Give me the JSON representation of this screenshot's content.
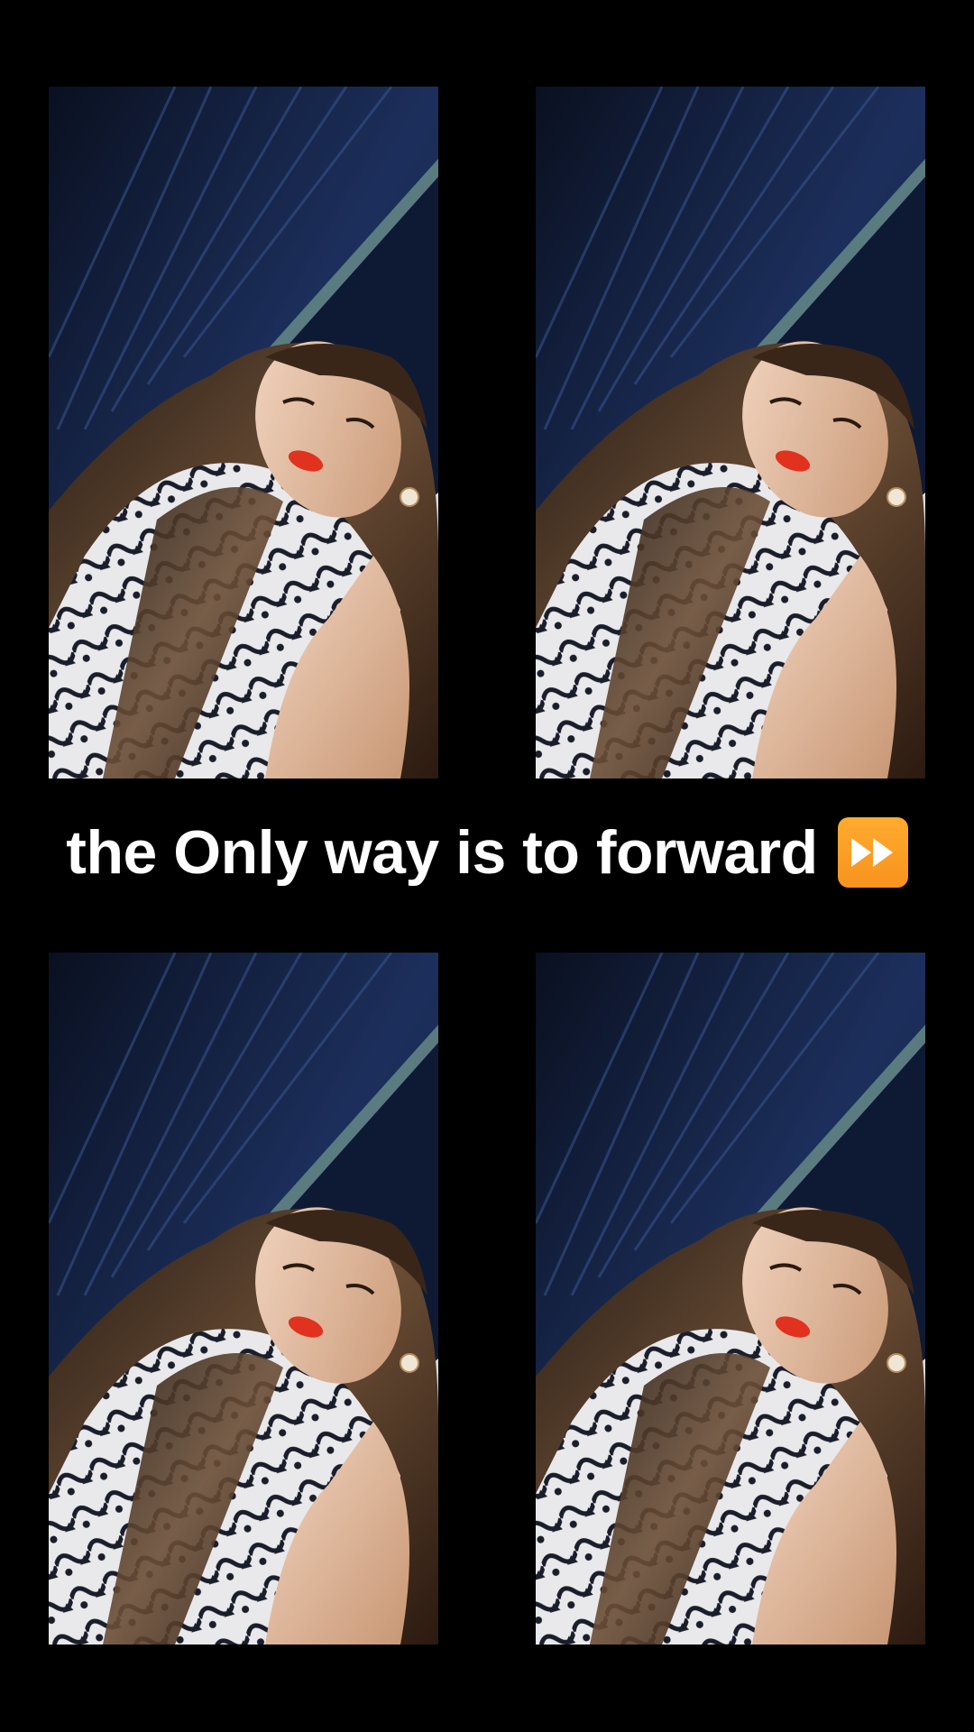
{
  "caption": {
    "text": "the Only way is to forward",
    "icon": "fast-forward-icon",
    "icon_color": "#f7931e"
  },
  "photos": [
    {
      "name": "selfie-photo-top-left"
    },
    {
      "name": "selfie-photo-top-right"
    },
    {
      "name": "selfie-photo-bottom-left"
    },
    {
      "name": "selfie-photo-bottom-right"
    }
  ],
  "colors": {
    "background": "#000000",
    "caption_text": "#ffffff",
    "curtain": "#1c2f5c",
    "lipstick": "#e0321e"
  }
}
